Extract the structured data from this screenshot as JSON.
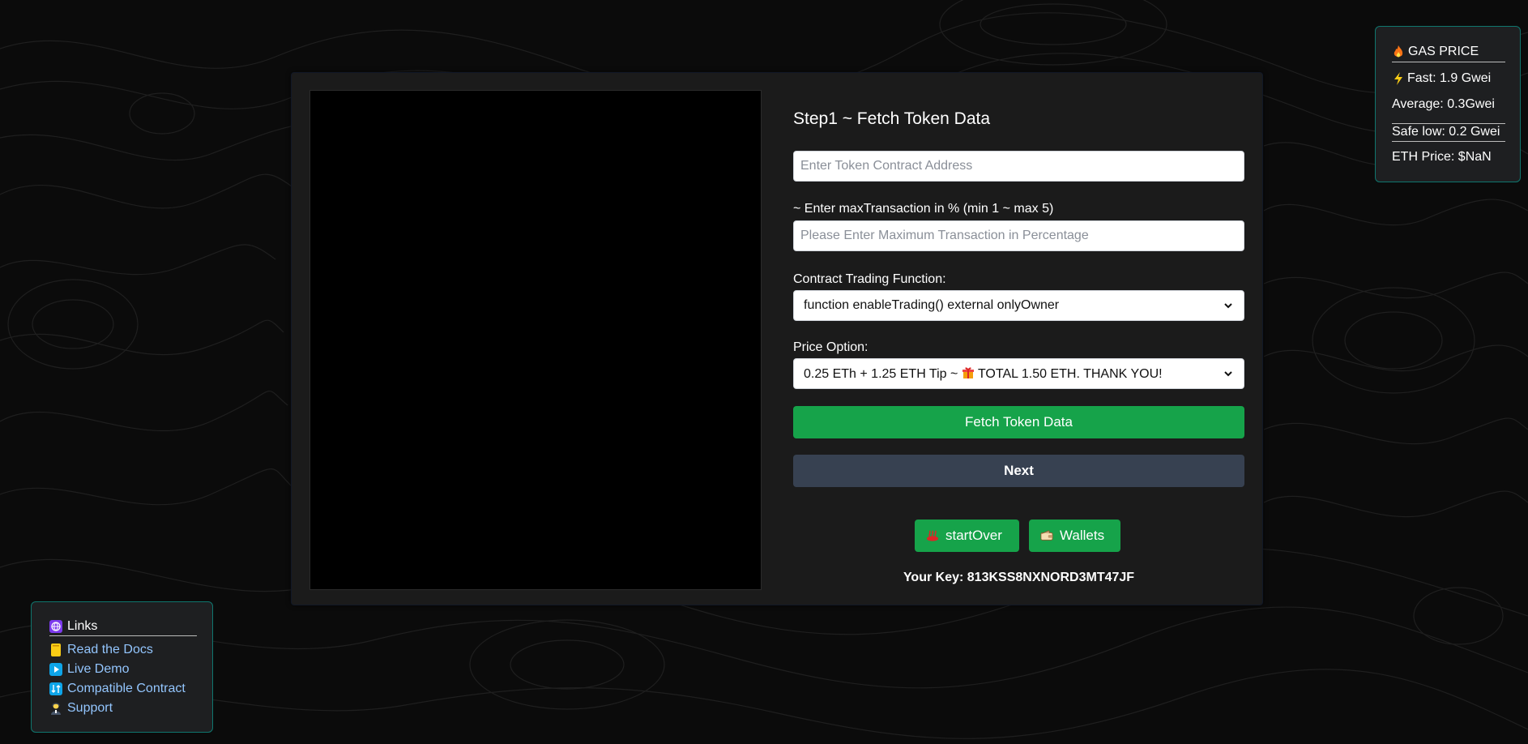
{
  "form": {
    "step_title": "Step1 ~ Fetch Token Data",
    "contract_address": {
      "placeholder": "Enter Token Contract Address",
      "value": ""
    },
    "max_tx_label": "~ Enter maxTransaction in % (min 1 ~ max 5)",
    "max_tx": {
      "placeholder": "Please Enter Maximum Transaction in Percentage",
      "value": ""
    },
    "trading_function_label": "Contract Trading Function:",
    "trading_function_selected": "function enableTrading() external onlyOwner",
    "price_option_label": "Price Option:",
    "price_option_selected_prefix": "0.25 ETh + 1.25 ETH Tip ~",
    "price_option_selected_suffix": "TOTAL 1.50 ETH. THANK YOU!",
    "fetch_button_label": "Fetch Token Data",
    "next_button_label": "Next",
    "start_over_label": "startOver",
    "wallets_label": "Wallets",
    "key_line": "Your Key: 813KSS8NXNORD3MT47JF"
  },
  "gas_price": {
    "title": "GAS PRICE",
    "fast": "Fast: 1.9 Gwei",
    "average": "Average: 0.3Gwei",
    "safe_low": "Safe low: 0.2 Gwei",
    "eth_price": "ETH Price: $NaN"
  },
  "links": {
    "title": "Links",
    "items": [
      {
        "label": "Read the Docs",
        "icon": "book-icon"
      },
      {
        "label": "Live Demo",
        "icon": "play-icon"
      },
      {
        "label": "Compatible Contract",
        "icon": "swap-icon"
      },
      {
        "label": "Support",
        "icon": "support-agent-icon"
      }
    ]
  },
  "icons": {
    "gas_title": "fire-icon",
    "fast": "lightning-icon",
    "price_option_gift": "gift-icon",
    "start_over": "hot-springs-icon",
    "wallets": "wallet-icon",
    "links_title": "globe-icon"
  },
  "colors": {
    "accent_green": "#16a34a",
    "next_button": "#374151",
    "panel_border": "#0f766e",
    "link": "#93c5fd",
    "card": "#1b1b1b",
    "background": "#0b0b0b"
  }
}
